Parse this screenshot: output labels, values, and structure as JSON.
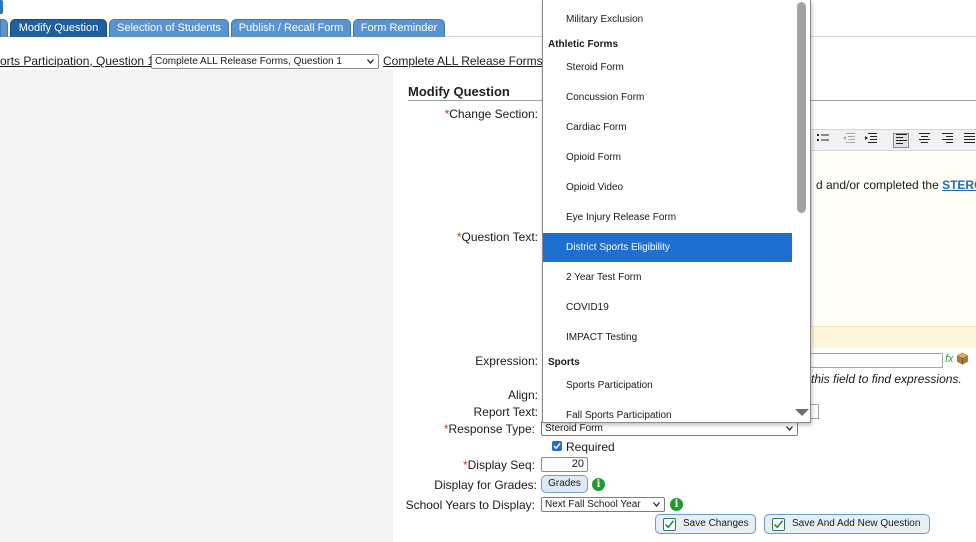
{
  "tabs": [
    {
      "label": "Modify Question",
      "active": true
    },
    {
      "label": "Selection of Students",
      "active": false
    },
    {
      "label": "Publish / Recall Form",
      "active": false
    },
    {
      "label": "Form Reminder",
      "active": false
    }
  ],
  "breadcrumb": {
    "left_link": "orts Participation, Question 1",
    "select_value": "Complete ALL Release Forms, Question 1",
    "right_link": "Complete ALL Release Forms,"
  },
  "form": {
    "title": "Modify Question",
    "labels": {
      "change_section": "Change Section:",
      "question_text": "Question Text:",
      "expression": "Expression:",
      "align": "Align:",
      "report_text": "Report Text:",
      "response_type": "Response Type:",
      "display_seq": "Display Seq:",
      "display_for_grades": "Display for Grades:",
      "school_years": "School Years to Display:"
    },
    "required_marker": "*",
    "editor_text": "d and/or completed the ",
    "editor_link": "STEROID I",
    "expression_hint": "this field to find expressions.",
    "fx_label": "fx",
    "response_type_value": "Steroid Form",
    "required_label": "Required",
    "required_checked": true,
    "display_seq_value": "20",
    "grades_button": "Grades",
    "school_year_value": "Next Fall School Year",
    "save_changes": "Save Changes",
    "save_and_add": "Save And Add New Question"
  },
  "dropdown": {
    "items": [
      {
        "kind": "option",
        "label": "Military Exclusion"
      },
      {
        "kind": "group",
        "label": "Athletic Forms"
      },
      {
        "kind": "option",
        "label": "Steroid Form"
      },
      {
        "kind": "option",
        "label": "Concussion Form"
      },
      {
        "kind": "option",
        "label": "Cardiac Form"
      },
      {
        "kind": "option",
        "label": "Opioid Form"
      },
      {
        "kind": "option",
        "label": "Opioid Video"
      },
      {
        "kind": "option",
        "label": "Eye Injury Release Form"
      },
      {
        "kind": "option",
        "label": "District Sports Eligibility",
        "selected": true
      },
      {
        "kind": "option",
        "label": "2 Year Test Form"
      },
      {
        "kind": "option",
        "label": "COVID19"
      },
      {
        "kind": "option",
        "label": "IMPACT Testing"
      },
      {
        "kind": "group",
        "label": "Sports"
      },
      {
        "kind": "option",
        "label": "Sports Participation"
      },
      {
        "kind": "option",
        "label": "Fall Sports Participation"
      }
    ]
  },
  "colors": {
    "tab": "#5a93cf",
    "tab_active": "#1f5f9e",
    "selected_option": "#1f6fd0",
    "info_icon": "#1e9a2e",
    "link": "#1b6fb8"
  },
  "icons": {
    "info": "info-icon",
    "caret": "chevron-down-icon",
    "fx": "fx-icon",
    "cube": "cube-icon",
    "check": "checkmark-icon"
  },
  "info_glyph": "i"
}
